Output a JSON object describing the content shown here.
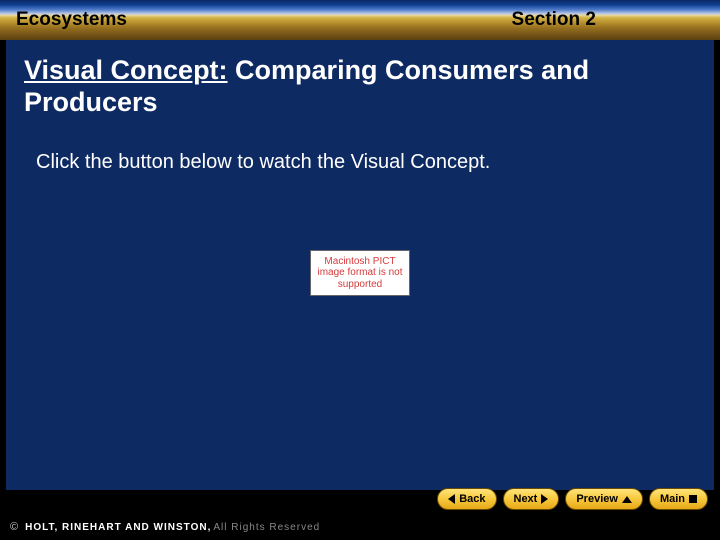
{
  "banner": {
    "chapter": "Ecosystems",
    "section": "Section 2"
  },
  "slide": {
    "title_prefix": "Visual Concept:",
    "title_rest": " Comparing Consumers and Producers",
    "instruction": "Click the button below to watch the Visual Concept.",
    "placeholder_text": "Macintosh PICT image format is not supported"
  },
  "nav": {
    "back": "Back",
    "next": "Next",
    "preview": "Preview",
    "main": "Main"
  },
  "footer": {
    "copy": "©",
    "brand": "HOLT, RINEHART AND WINSTON,",
    "rights": " All Rights Reserved"
  }
}
